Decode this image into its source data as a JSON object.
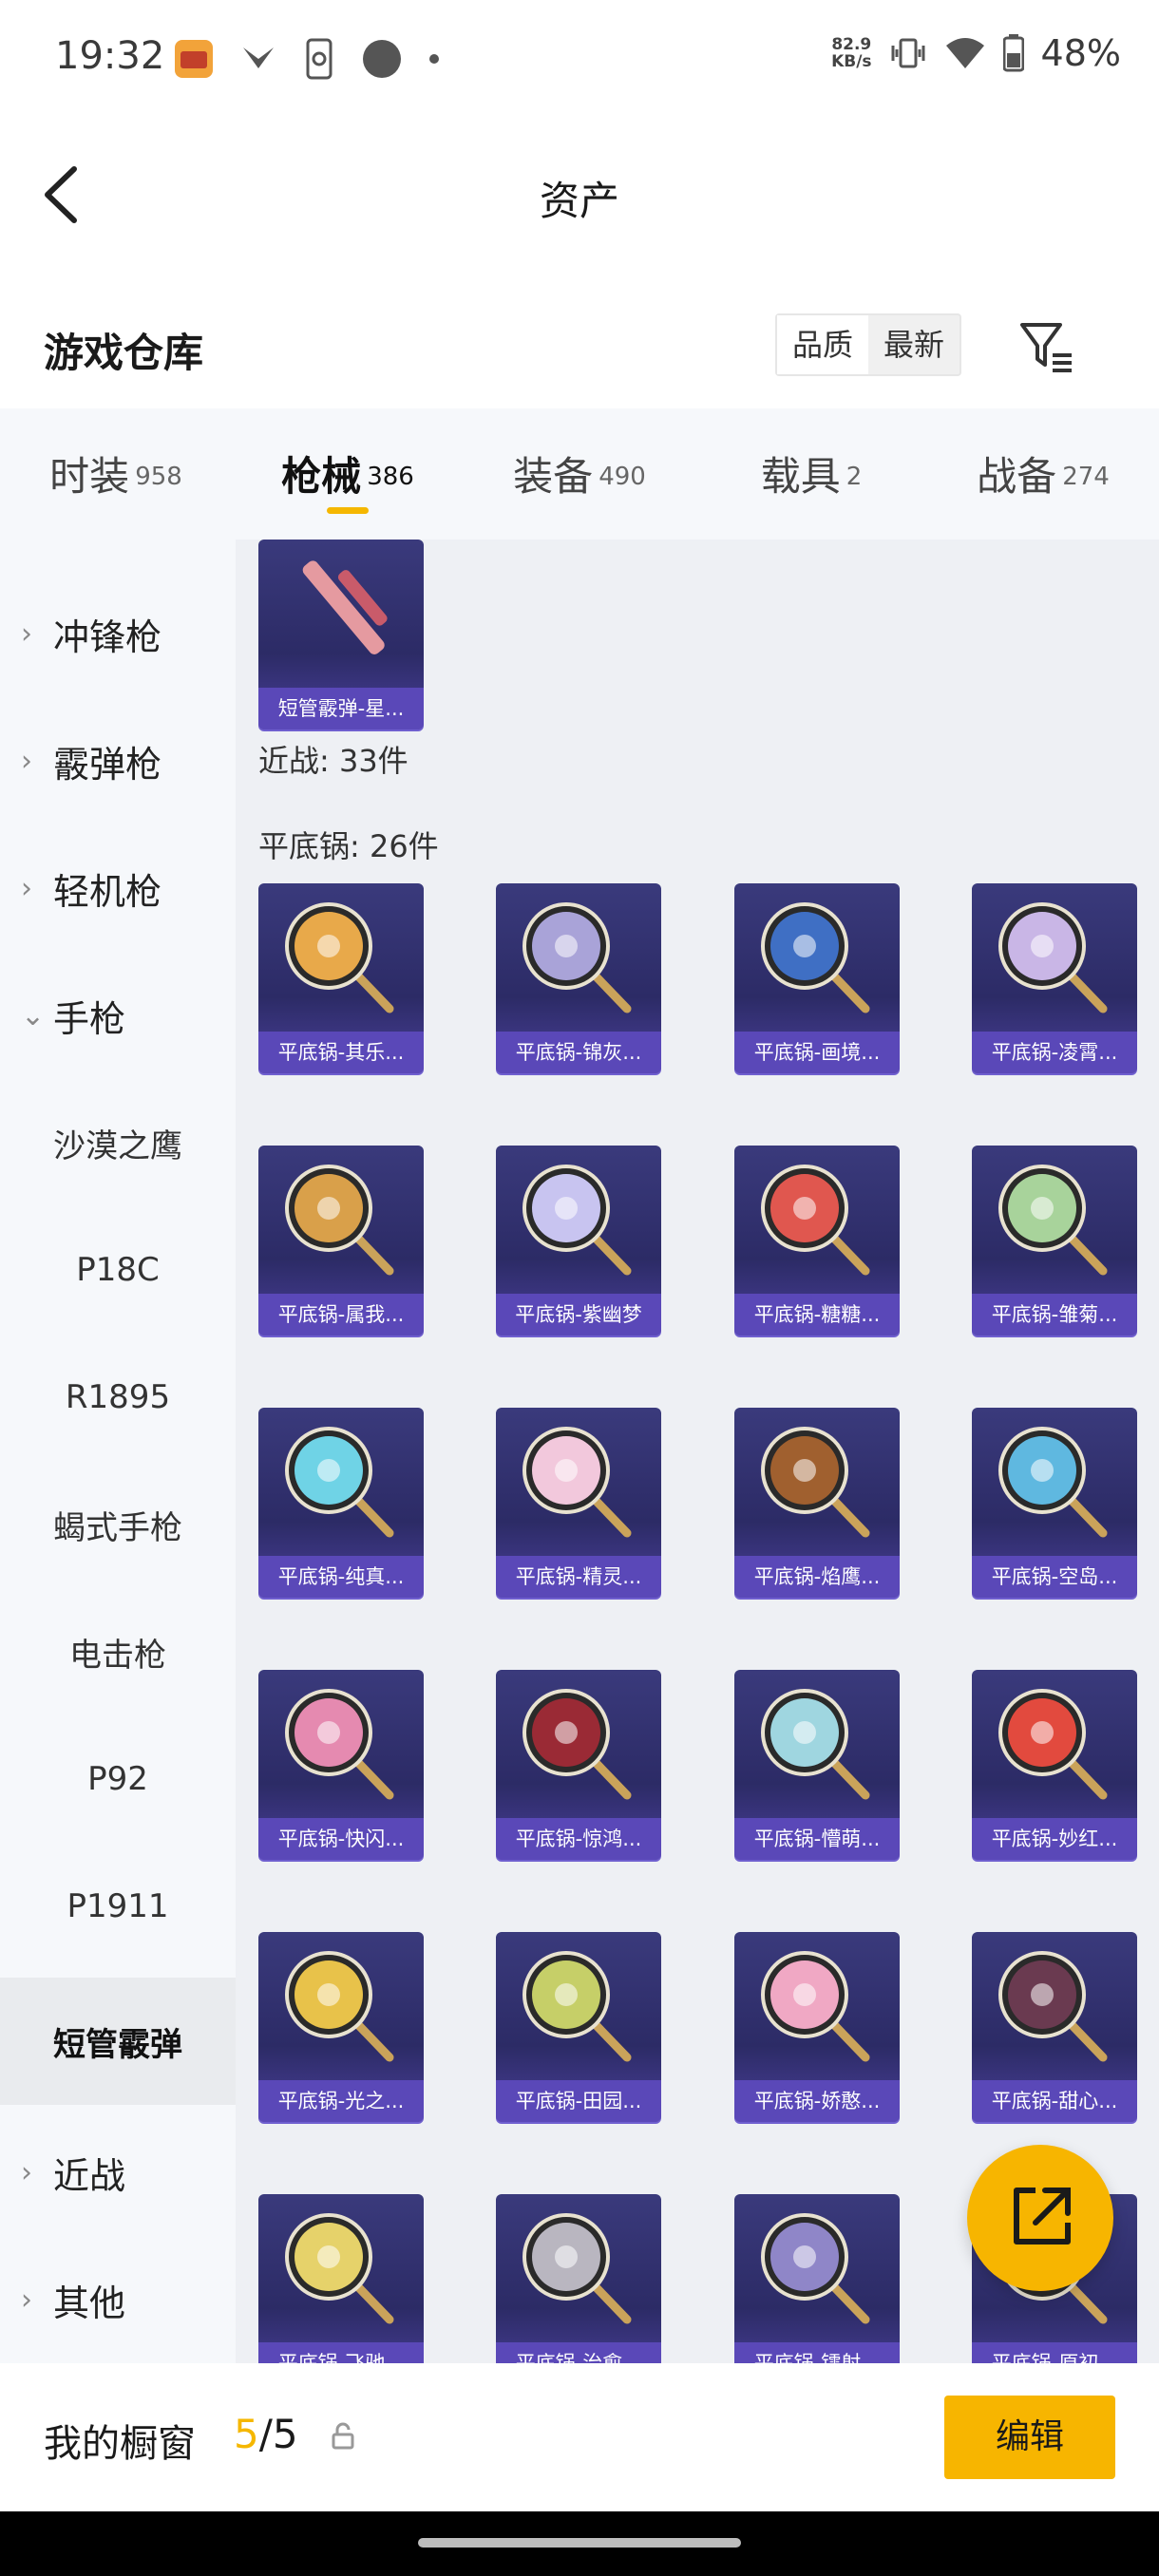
{
  "status_bar": {
    "time": "19:32",
    "net_speed_value": "82.9",
    "net_speed_unit": "KB/s",
    "battery": "48%"
  },
  "header": {
    "title": "资产"
  },
  "warehouse": {
    "title": "游戏仓库",
    "sort_options": [
      "品质",
      "最新"
    ],
    "sort_active": "品质"
  },
  "tabs": [
    {
      "label": "时装",
      "count": "958"
    },
    {
      "label": "枪械",
      "count": "386",
      "active": true
    },
    {
      "label": "装备",
      "count": "490"
    },
    {
      "label": "载具",
      "count": "2"
    },
    {
      "label": "战备",
      "count": "274"
    }
  ],
  "sidebar": {
    "items": [
      {
        "label": "冲锋枪",
        "type": "group"
      },
      {
        "label": "霰弹枪",
        "type": "group"
      },
      {
        "label": "轻机枪",
        "type": "group"
      },
      {
        "label": "手枪",
        "type": "group-open"
      },
      {
        "label": "沙漠之鹰",
        "type": "sub"
      },
      {
        "label": "P18C",
        "type": "sub"
      },
      {
        "label": "R1895",
        "type": "sub"
      },
      {
        "label": "蝎式手枪",
        "type": "sub"
      },
      {
        "label": "电击枪",
        "type": "sub"
      },
      {
        "label": "P92",
        "type": "sub"
      },
      {
        "label": "P1911",
        "type": "sub"
      },
      {
        "label": "短管霰弹",
        "type": "sub-active"
      },
      {
        "label": "近战",
        "type": "group"
      },
      {
        "label": "其他",
        "type": "group"
      }
    ]
  },
  "content": {
    "top_card": {
      "name": "短管霰弹-星..."
    },
    "melee_label": "近战: 33件",
    "pan_label": "平底锅: 26件",
    "pan_items": [
      {
        "name": "平底锅-其乐...",
        "color": "#e8a94a"
      },
      {
        "name": "平底锅-锦灰...",
        "color": "#a9a3d8"
      },
      {
        "name": "平底锅-画境...",
        "color": "#3f6fc4"
      },
      {
        "name": "平底锅-凌霄...",
        "color": "#c9b6e6"
      },
      {
        "name": "平底锅-属我...",
        "color": "#d9a04a"
      },
      {
        "name": "平底锅-紫幽梦",
        "color": "#c8c4f0"
      },
      {
        "name": "平底锅-糖糖...",
        "color": "#e0574f"
      },
      {
        "name": "平底锅-雏菊...",
        "color": "#a8d39b"
      },
      {
        "name": "平底锅-纯真...",
        "color": "#6fd3e6"
      },
      {
        "name": "平底锅-精灵...",
        "color": "#f2c8dc"
      },
      {
        "name": "平底锅-焰鹰...",
        "color": "#a0602f"
      },
      {
        "name": "平底锅-空岛...",
        "color": "#5fb8e0"
      },
      {
        "name": "平底锅-快闪...",
        "color": "#e58ab0"
      },
      {
        "name": "平底锅-惊鸿...",
        "color": "#9a2a35"
      },
      {
        "name": "平底锅-懵萌...",
        "color": "#9fd6e0"
      },
      {
        "name": "平底锅-妙红...",
        "color": "#e24a3e"
      },
      {
        "name": "平底锅-光之...",
        "color": "#e8c24a"
      },
      {
        "name": "平底锅-田园...",
        "color": "#c6cf68"
      },
      {
        "name": "平底锅-娇憨...",
        "color": "#f0a8c4"
      },
      {
        "name": "平底锅-甜心...",
        "color": "#6a3a50"
      },
      {
        "name": "平底锅-飞驰...",
        "color": "#e6d26a"
      },
      {
        "name": "平底锅-治愈...",
        "color": "#b9b6c0"
      },
      {
        "name": "平底锅-镭射...",
        "color": "#8f86c8"
      },
      {
        "name": "平底锅-原初...",
        "color": "#d64a4a"
      }
    ]
  },
  "showcase": {
    "label": "我的橱窗",
    "current": "5",
    "total": "/5",
    "edit_label": "编辑"
  }
}
